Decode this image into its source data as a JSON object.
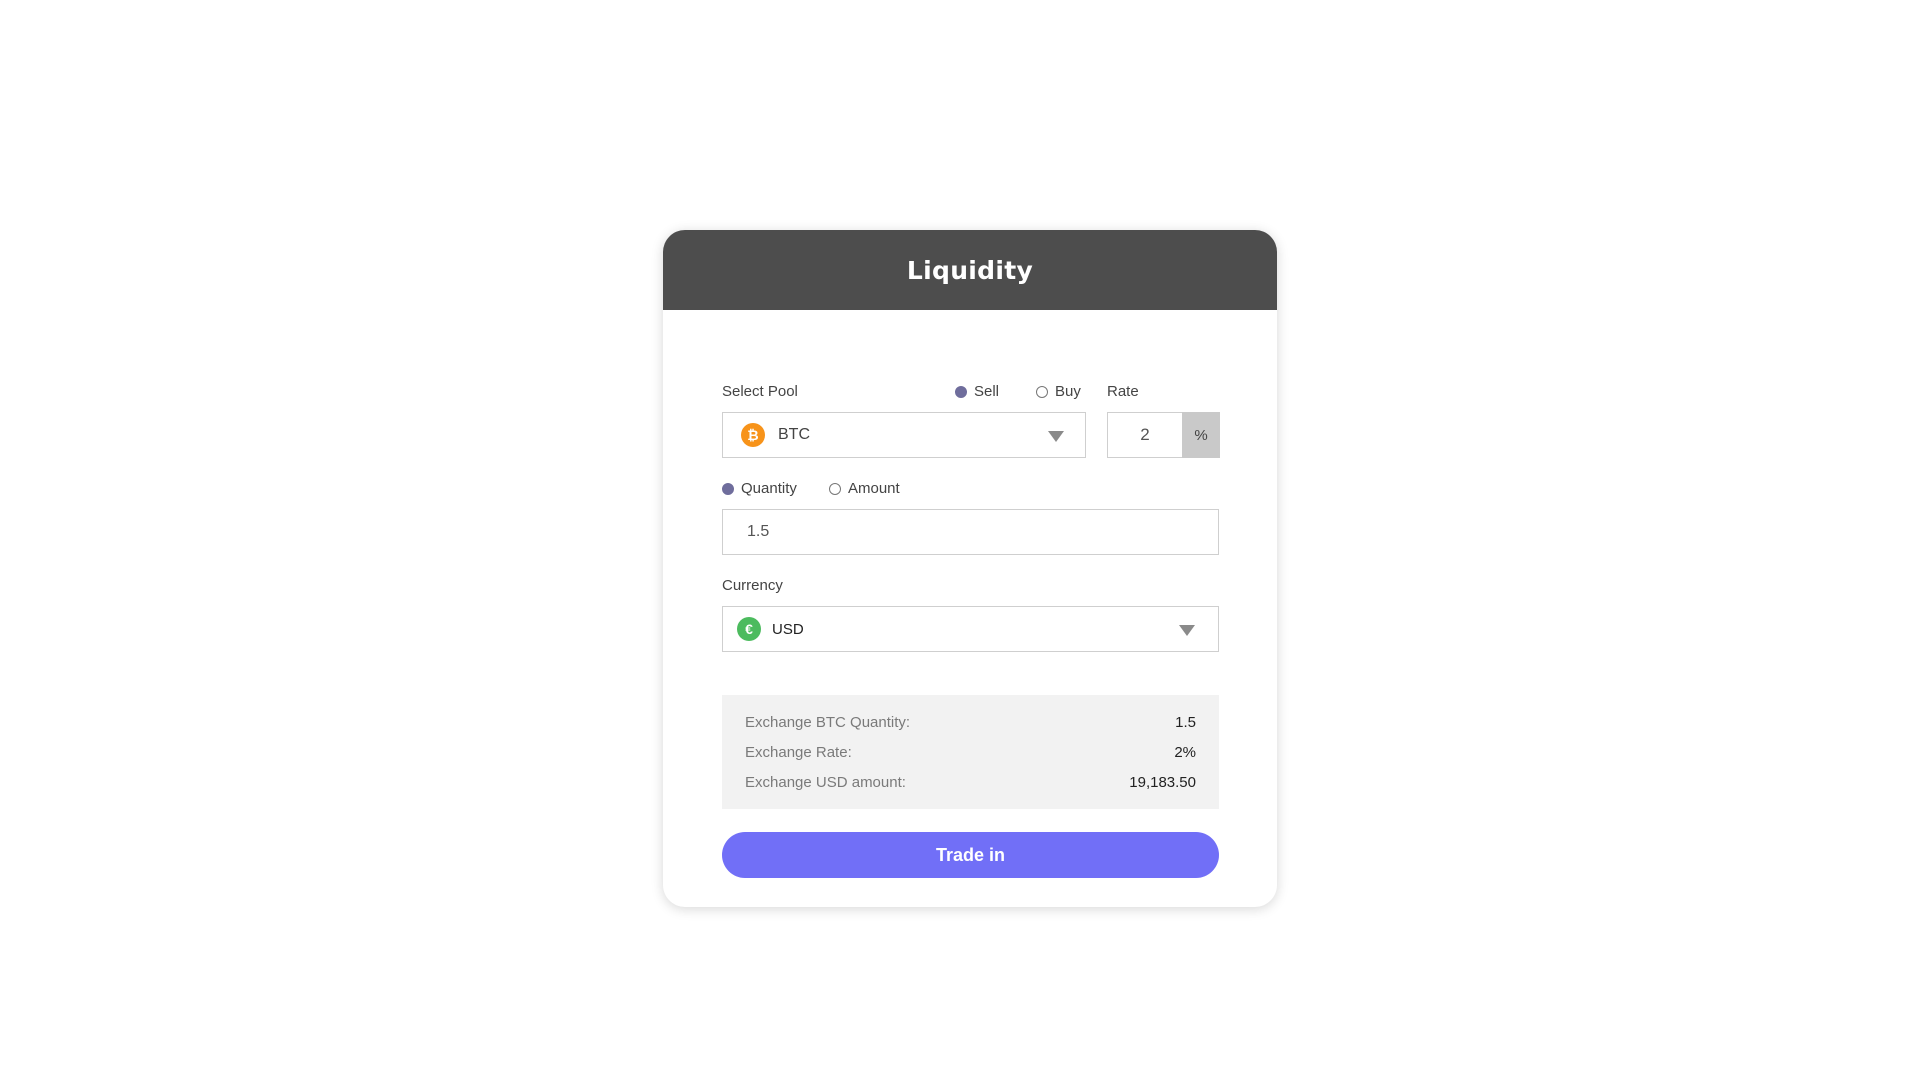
{
  "header": {
    "title": "Liquidity"
  },
  "pool": {
    "label": "Select Pool",
    "selected": "BTC",
    "coin_symbol": "₿",
    "coin_color": "#f7931a"
  },
  "side": {
    "options": [
      {
        "label": "Sell",
        "selected": true
      },
      {
        "label": "Buy",
        "selected": false
      }
    ]
  },
  "rate": {
    "label": "Rate",
    "value": "2",
    "unit": "%"
  },
  "mode": {
    "options": [
      {
        "label": "Quantity",
        "selected": true
      },
      {
        "label": "Amount",
        "selected": false
      }
    ]
  },
  "quantity": {
    "value": "1.5"
  },
  "currency": {
    "label": "Currency",
    "selected": "USD",
    "coin_symbol": "€",
    "coin_color": "#4cbb5e"
  },
  "summary": {
    "rows": [
      {
        "label": "Exchange BTC Quantity:",
        "value": "1.5"
      },
      {
        "label": "Exchange Rate:",
        "value": "2%"
      },
      {
        "label": "Exchange USD amount:",
        "value": "19,183.50"
      }
    ]
  },
  "actions": {
    "trade_label": "Trade in"
  },
  "colors": {
    "accent": "#716ff7",
    "header": "#4d4d4d",
    "radio_selected": "#6f6d9c"
  }
}
